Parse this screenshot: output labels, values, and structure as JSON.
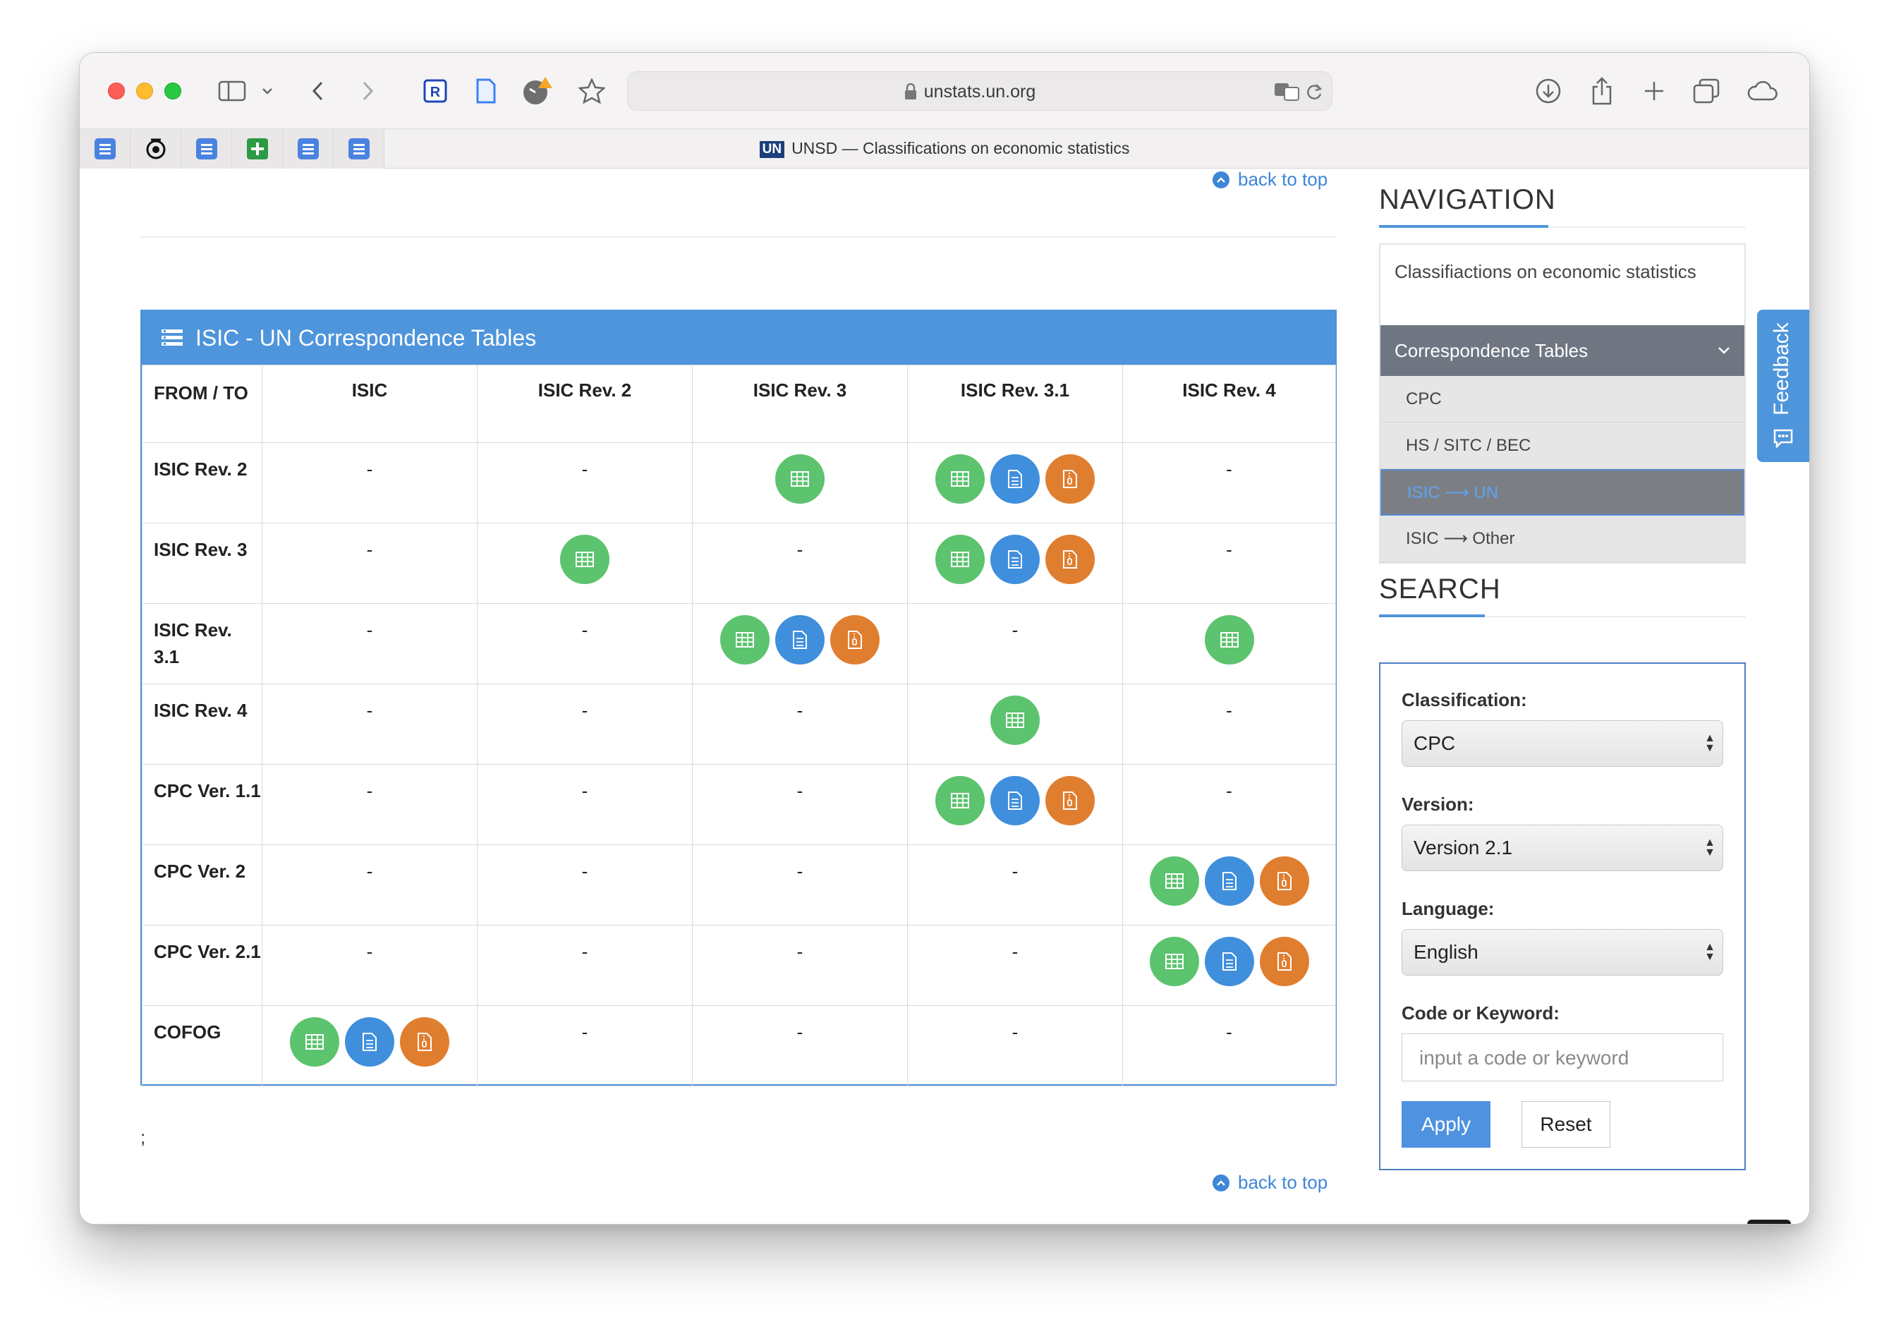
{
  "browser": {
    "url": "unstats.un.org",
    "tab_title": "UNSD — Classifications on economic statistics",
    "tab_logo": "UN"
  },
  "page": {
    "back_to_top": "back to top",
    "semicolon": ";"
  },
  "table": {
    "title": "ISIC - UN Correspondence Tables",
    "columns": [
      "FROM / TO",
      "ISIC",
      "ISIC Rev. 2",
      "ISIC Rev. 3",
      "ISIC Rev. 3.1",
      "ISIC Rev. 4"
    ],
    "rows": [
      {
        "label": "ISIC Rev. 2",
        "cells": [
          "-",
          "-",
          "xls",
          "xls,doc,zip",
          "-"
        ]
      },
      {
        "label": "ISIC Rev. 3",
        "cells": [
          "-",
          "xls",
          "-",
          "xls,doc,zip",
          "-"
        ]
      },
      {
        "label": "ISIC Rev. 3.1",
        "cells": [
          "-",
          "-",
          "xls,doc,zip",
          "-",
          "xls"
        ]
      },
      {
        "label": "ISIC Rev. 4",
        "cells": [
          "-",
          "-",
          "-",
          "xls",
          "-"
        ]
      },
      {
        "label": "CPC Ver. 1.1",
        "cells": [
          "-",
          "-",
          "-",
          "xls,doc,zip",
          "-"
        ]
      },
      {
        "label": "CPC Ver. 2",
        "cells": [
          "-",
          "-",
          "-",
          "-",
          "xls,doc,zip"
        ]
      },
      {
        "label": "CPC Ver. 2.1",
        "cells": [
          "-",
          "-",
          "-",
          "-",
          "xls,doc,zip"
        ]
      },
      {
        "label": "COFOG",
        "cells": [
          "xls,doc,zip",
          "-",
          "-",
          "-",
          "-"
        ]
      }
    ],
    "icon_colors": {
      "xls": "#5cc36e",
      "doc": "#3f8fdc",
      "zip": "#e07e2f"
    }
  },
  "navigation": {
    "heading": "NAVIGATION",
    "first_item": "Classifiactions on economic statistics",
    "active_item": "Correspondence Tables",
    "sub_items": [
      "CPC",
      "HS / SITC / BEC",
      "ISIC ⟶ UN",
      "ISIC ⟶ Other"
    ]
  },
  "search": {
    "heading": "SEARCH",
    "classification_label": "Classification:",
    "classification_value": "CPC",
    "version_label": "Version:",
    "version_value": "Version 2.1",
    "language_label": "Language:",
    "language_value": "English",
    "keyword_label": "Code or Keyword:",
    "keyword_placeholder": "input a code or keyword",
    "apply_label": "Apply",
    "reset_label": "Reset"
  },
  "feedback": {
    "label": "Feedback"
  }
}
